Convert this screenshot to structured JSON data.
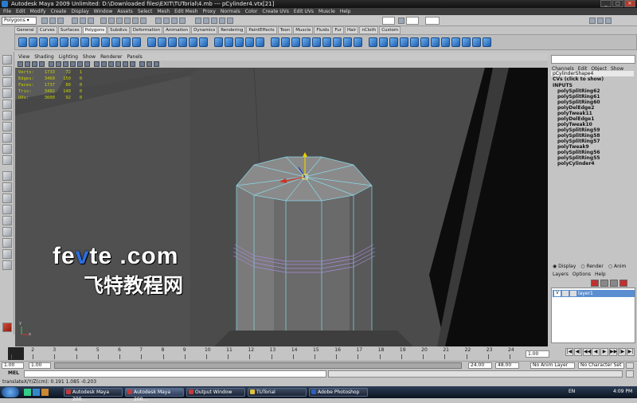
{
  "window": {
    "title": "Autodesk Maya 2009 Unlimited: D:\\Downloaded files\\EXIT\\TUTorial\\4.mb   ---   pCylinder4.vtx[21]"
  },
  "menubar": [
    "File",
    "Edit",
    "Modify",
    "Create",
    "Display",
    "Window",
    "Assets",
    "Select",
    "Mesh",
    "Edit Mesh",
    "Proxy",
    "Normals",
    "Color",
    "Create UVs",
    "Edit UVs",
    "Muscle",
    "Help"
  ],
  "statusline": {
    "mode": "Polygons"
  },
  "shelf_tabs": [
    "General",
    "Curves",
    "Surfaces",
    "Polygons",
    "Subdivs",
    "Deformation",
    "Animation",
    "Dynamics",
    "Rendering",
    "PaintEffects",
    "Toon",
    "Muscle",
    "Fluids",
    "Fur",
    "Hair",
    "nCloth",
    "Custom"
  ],
  "active_shelf_tab": "Polygons",
  "viewport": {
    "menu": [
      "View",
      "Shading",
      "Lighting",
      "Show",
      "Renderer",
      "Panels"
    ],
    "hud": [
      {
        "label": "Verts:",
        "a": "1733",
        "b": "72",
        "c": "1"
      },
      {
        "label": "Edges:",
        "a": "3460",
        "b": "150",
        "c": "0"
      },
      {
        "label": "Faces:",
        "a": "1737",
        "b": "80",
        "c": "0"
      },
      {
        "label": "Tris:",
        "a": "3402",
        "b": "140",
        "c": "0"
      },
      {
        "label": "UVs:",
        "a": "3600",
        "b": "92",
        "c": "0"
      }
    ],
    "axis_labels": {
      "x": "x",
      "y": "y"
    },
    "watermark": {
      "pre": "fe",
      "accent": "v",
      "post": "te .com",
      "chinese": "飞特教程网"
    }
  },
  "channelbox": {
    "menu": [
      "Channels",
      "Edit",
      "Object",
      "Show"
    ],
    "shape": "pCylinderShape4",
    "cvs": "CVs (click to show)",
    "inputs_label": "INPUTS",
    "inputs": [
      "polySplitRing62",
      "polySplitRing61",
      "polySplitRing60",
      "polyDelEdge2",
      "polyTweak11",
      "polyDelEdge1",
      "polyTweak10",
      "polySplitRing59",
      "polySplitRing58",
      "polySplitRing57",
      "polyTweak9",
      "polySplitRing56",
      "polySplitRing55",
      "polyCylinder4"
    ]
  },
  "layer_editor": {
    "radios": [
      "Display",
      "Render",
      "Anim"
    ],
    "menu": [
      "Layers",
      "Options",
      "Help"
    ],
    "layer": {
      "v": "V",
      "name": "layer1"
    }
  },
  "timeline": {
    "ticks": [
      "1",
      "2",
      "3",
      "4",
      "5",
      "6",
      "7",
      "8",
      "9",
      "10",
      "11",
      "12",
      "13",
      "14",
      "15",
      "16",
      "17",
      "18",
      "19",
      "20",
      "21",
      "22",
      "23",
      "24"
    ],
    "current": "1.00",
    "range_start": "1.00",
    "range_start2": "1.00",
    "range_end": "24.00",
    "range_end2": "48.00",
    "anim_layer": "No Anim Layer",
    "char_set": "No Character Set"
  },
  "cmdline": {
    "label": "MEL"
  },
  "helpline": {
    "text": "translateX/Y/Z(cm):  0.191       1.085       -0.203"
  },
  "taskbar": {
    "buttons": [
      "Autodesk Maya 200...",
      "Autodesk Maya 200...",
      "Output Window",
      "TUTorial",
      "Adobe Photoshop"
    ],
    "lang": "EN",
    "clock": "4:09 PM"
  },
  "colors": {
    "viewport_bg": "#4a4a4a",
    "wireframe": "#8ad8e8",
    "hud_text": "#c8d200",
    "layer_selected": "#5a8ed0"
  }
}
